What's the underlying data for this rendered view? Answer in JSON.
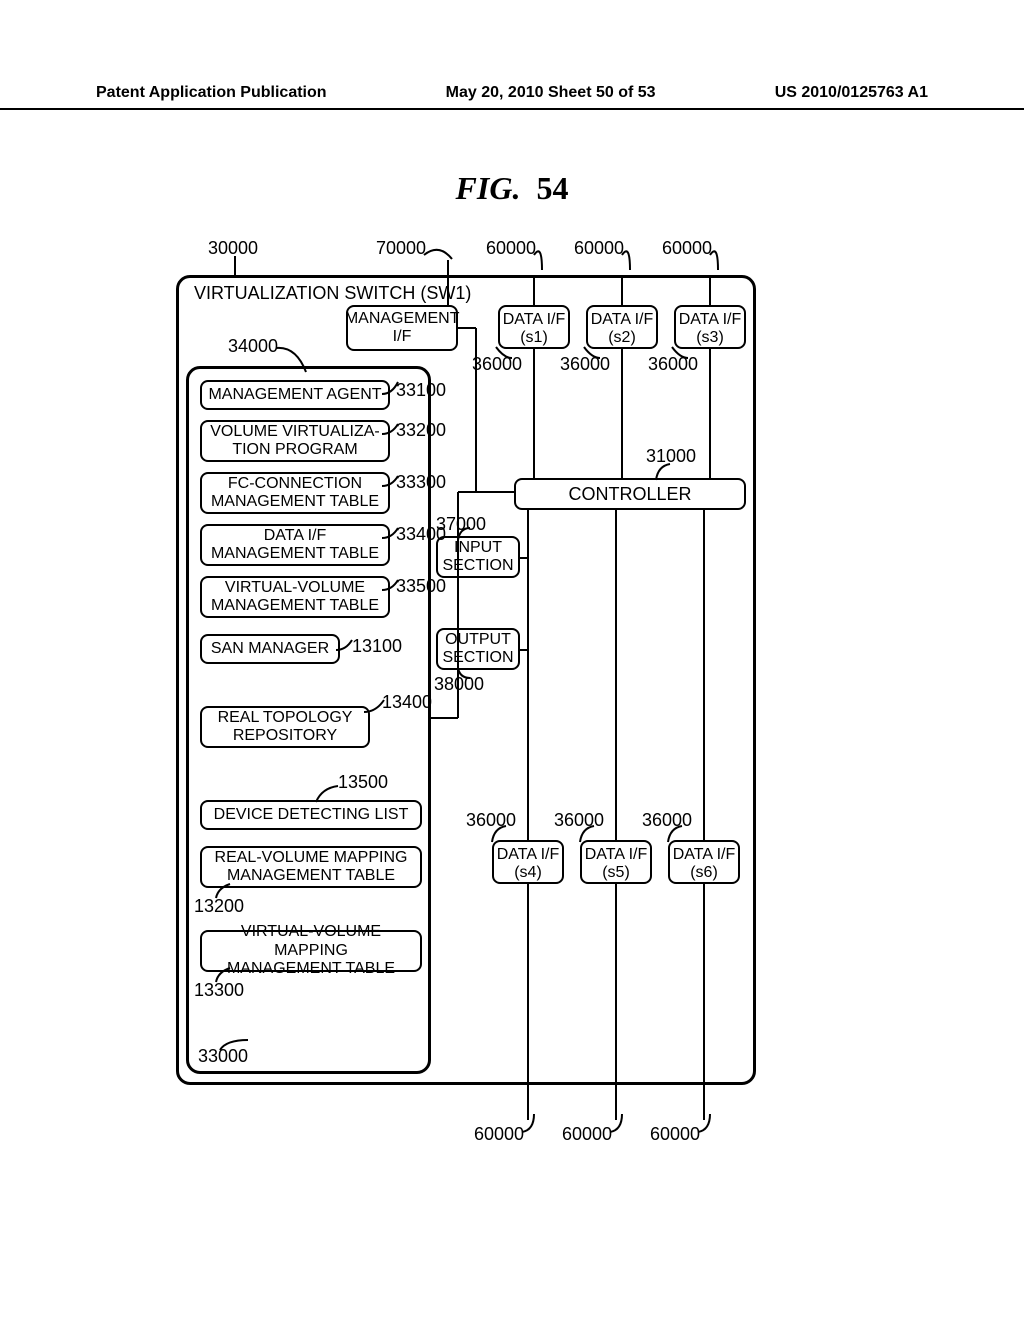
{
  "header": {
    "left": "Patent Application Publication",
    "center": "May 20, 2010  Sheet 50 of 53",
    "right": "US 2010/0125763 A1"
  },
  "figure_title": {
    "prefix": "FIG.",
    "number": "54"
  },
  "outer": {
    "title": "VIRTUALIZATION SWITCH (SW1)",
    "ref_outer": "30000",
    "ref_inner_panel": "33000",
    "ref_title_marker": "34000"
  },
  "mgmt_if": {
    "label": "MANAGEMENT I/F",
    "ref": "70000"
  },
  "data_if_top": [
    {
      "label": "DATA I/F",
      "port": "(s1)",
      "ref_outer": "60000",
      "ref_inner": "36000"
    },
    {
      "label": "DATA I/F",
      "port": "(s2)",
      "ref_outer": "60000",
      "ref_inner": "36000"
    },
    {
      "label": "DATA I/F",
      "port": "(s3)",
      "ref_outer": "60000",
      "ref_inner": "36000"
    }
  ],
  "data_if_bottom": [
    {
      "label": "DATA I/F",
      "port": "(s4)",
      "ref_outer": "60000",
      "ref_inner": "36000"
    },
    {
      "label": "DATA I/F",
      "port": "(s5)",
      "ref_outer": "60000",
      "ref_inner": "36000"
    },
    {
      "label": "DATA I/F",
      "port": "(s6)",
      "ref_outer": "60000",
      "ref_inner": "36000"
    }
  ],
  "controller": {
    "label": "CONTROLLER",
    "ref": "31000"
  },
  "input_section": {
    "label1": "INPUT",
    "label2": "SECTION",
    "ref": "37000"
  },
  "output_section": {
    "label1": "OUTPUT",
    "label2": "SECTION",
    "ref": "38000"
  },
  "panel_items": [
    {
      "label": "MANAGEMENT AGENT",
      "ref": "33100"
    },
    {
      "label": "VOLUME VIRTUALIZA-\nTION PROGRAM",
      "ref": "33200"
    },
    {
      "label": "FC-CONNECTION\nMANAGEMENT TABLE",
      "ref": "33300"
    },
    {
      "label": "DATA I/F\nMANAGEMENT TABLE",
      "ref": "33400"
    },
    {
      "label": "VIRTUAL-VOLUME\nMANAGEMENT TABLE",
      "ref": "33500"
    },
    {
      "label": "SAN MANAGER",
      "ref": "13100"
    },
    {
      "label": "REAL TOPOLOGY\nREPOSITORY",
      "ref": "13400"
    },
    {
      "label": "DEVICE DETECTING LIST",
      "ref": "13500"
    },
    {
      "label": "REAL-VOLUME MAPPING\nMANAGEMENT TABLE",
      "ref": "13200"
    },
    {
      "label": "VIRTUAL-VOLUME MAPPING\nMANAGEMENT TABLE",
      "ref": "13300"
    }
  ]
}
